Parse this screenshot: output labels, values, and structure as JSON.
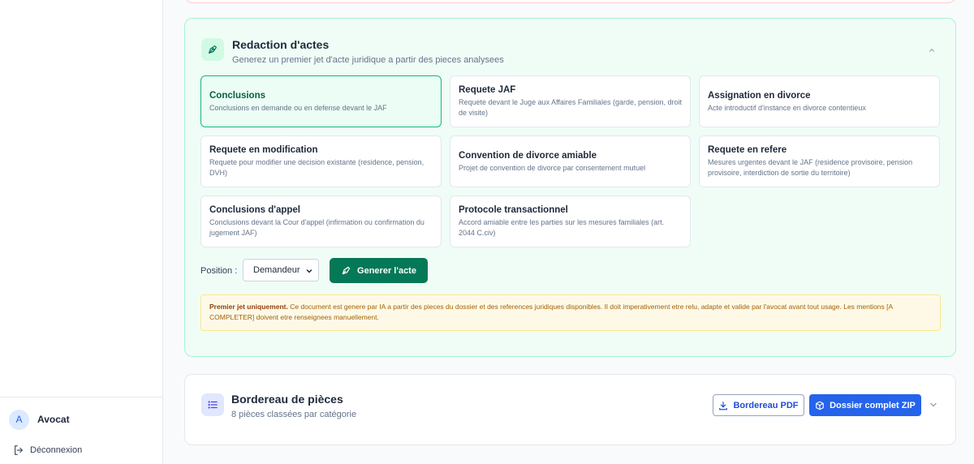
{
  "sidebar": {
    "user": {
      "initial": "A",
      "name": "Avocat"
    },
    "logout_label": "Déconnexion"
  },
  "redaction": {
    "title": "Redaction d'actes",
    "subtitle": "Generez un premier jet d'acte juridique a partir des pieces analysees",
    "icon": "pen-nib-icon",
    "options": [
      {
        "title": "Conclusions",
        "desc": "Conclusions en demande ou en defense devant le JAF",
        "selected": true
      },
      {
        "title": "Requete JAF",
        "desc": "Requete devant le Juge aux Affaires Familiales (garde, pension, droit de visite)",
        "selected": false
      },
      {
        "title": "Assignation en divorce",
        "desc": "Acte introductif d'instance en divorce contentieux",
        "selected": false
      },
      {
        "title": "Requete en modification",
        "desc": "Requete pour modifier une decision existante (residence, pension, DVH)",
        "selected": false
      },
      {
        "title": "Convention de divorce amiable",
        "desc": "Projet de convention de divorce par consentement mutuel",
        "selected": false
      },
      {
        "title": "Requete en refere",
        "desc": "Mesures urgentes devant le JAF (residence provisoire, pension provisoire, interdiction de sortie du territoire)",
        "selected": false
      },
      {
        "title": "Conclusions d'appel",
        "desc": "Conclusions devant la Cour d'appel (infirmation ou confirmation du jugement JAF)",
        "selected": false
      },
      {
        "title": "Protocole transactionnel",
        "desc": "Accord amiable entre les parties sur les mesures familiales (art. 2044 C.civ)",
        "selected": false
      }
    ],
    "position_label": "Position :",
    "position_value": "Demandeur",
    "generate_label": "Generer l'acte",
    "notice_bold": "Premier jet uniquement.",
    "notice_text": " Ce document est genere par IA a partir des pieces du dossier et des references juridiques disponibles. Il doit imperativement etre relu, adapte et valide par l'avocat avant tout usage. Les mentions [A COMPLETER] doivent etre renseignees manuellement."
  },
  "bordereau": {
    "title": "Bordereau de pièces",
    "subtitle": "8 pièces classées par catégorie",
    "pdf_label": "Bordereau PDF",
    "zip_label": "Dossier complet ZIP"
  },
  "colors": {
    "accent_green": "#047857",
    "accent_blue": "#2563eb",
    "notice_bg": "#fef9e7"
  }
}
